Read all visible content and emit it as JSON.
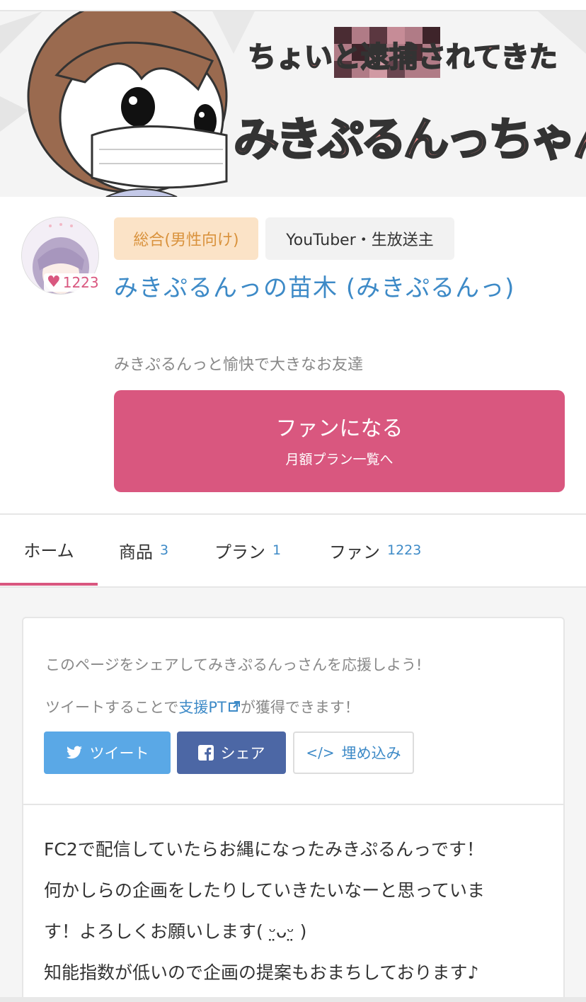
{
  "banner": {
    "subtitle": "ちょいと逮捕されてきた",
    "title": "みきぷるんっちゃん"
  },
  "profile": {
    "fan_count": "1223",
    "category_tag": "総合(男性向け)",
    "genre_tag": "YouTuber・生放送主",
    "name": "みきぷるんっの苗木 (みきぷるんっ)",
    "tagline": "みきぷるんっと愉快で大きなお友達",
    "fan_button_label": "ファンになる",
    "fan_button_sub": "月額プラン一覧へ"
  },
  "tabs": [
    {
      "label": "ホーム",
      "count": ""
    },
    {
      "label": "商品",
      "count": "3"
    },
    {
      "label": "プラン",
      "count": "1"
    },
    {
      "label": "ファン",
      "count": "1223"
    }
  ],
  "share": {
    "text_1": "このページをシェアしてみきぷるんっさんを応援しよう!",
    "text_2_prefix": "ツイートすることで",
    "text_2_link": "支援PT",
    "text_2_suffix": "が獲得できます！",
    "tweet_label": "ツイート",
    "share_label": "シェア",
    "embed_label": "埋め込み"
  },
  "bio": {
    "text": "FC2で配信していたらお縄になったみきぷるんっです！\n何かしらの企画をしたりしていきたいなーと思っていま\nす！よろしくお願いします( ᵕ̤ᴗᵕ̤ )\n知能指数が低いので企画の提案もおまちしております♪"
  },
  "colors": {
    "accent_pink": "#d9577f",
    "link_blue": "#3d8ac7",
    "twitter_blue": "#5aa8e6",
    "facebook_blue": "#4c67a5",
    "category_bg": "#fbe3c7"
  }
}
